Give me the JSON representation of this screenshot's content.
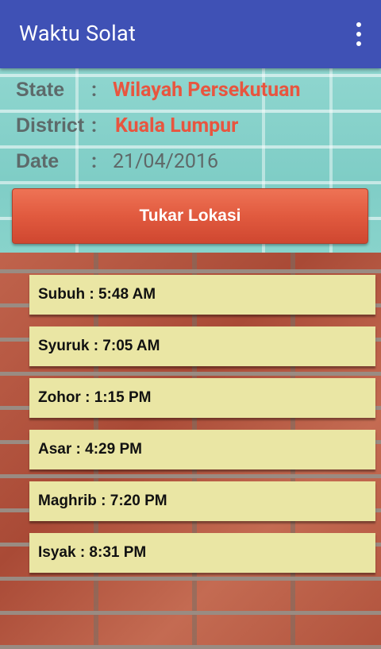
{
  "appbar": {
    "title": "Waktu Solat",
    "menu_icon": "overflow-menu-icon"
  },
  "location": {
    "state_label": "State",
    "state_colon": ":",
    "state_value": "Wilayah Persekutuan",
    "district_label": "District",
    "district_colon": ":",
    "district_value": "Kuala Lumpur",
    "date_label": "Date",
    "date_colon": ":",
    "date_value": "21/04/2016"
  },
  "change_location_button": "Tukar Lokasi",
  "prayers": [
    {
      "text": "Subuh : 5:48 AM"
    },
    {
      "text": "Syuruk : 7:05 AM"
    },
    {
      "text": "Zohor : 1:15 PM"
    },
    {
      "text": "Asar : 4:29 PM"
    },
    {
      "text": "Maghrib : 7:20 PM"
    },
    {
      "text": "Isyak : 8:31 PM"
    }
  ],
  "colors": {
    "appbar": "#3f51b5",
    "accent_red": "#e8553f",
    "card": "#eae6a4"
  }
}
